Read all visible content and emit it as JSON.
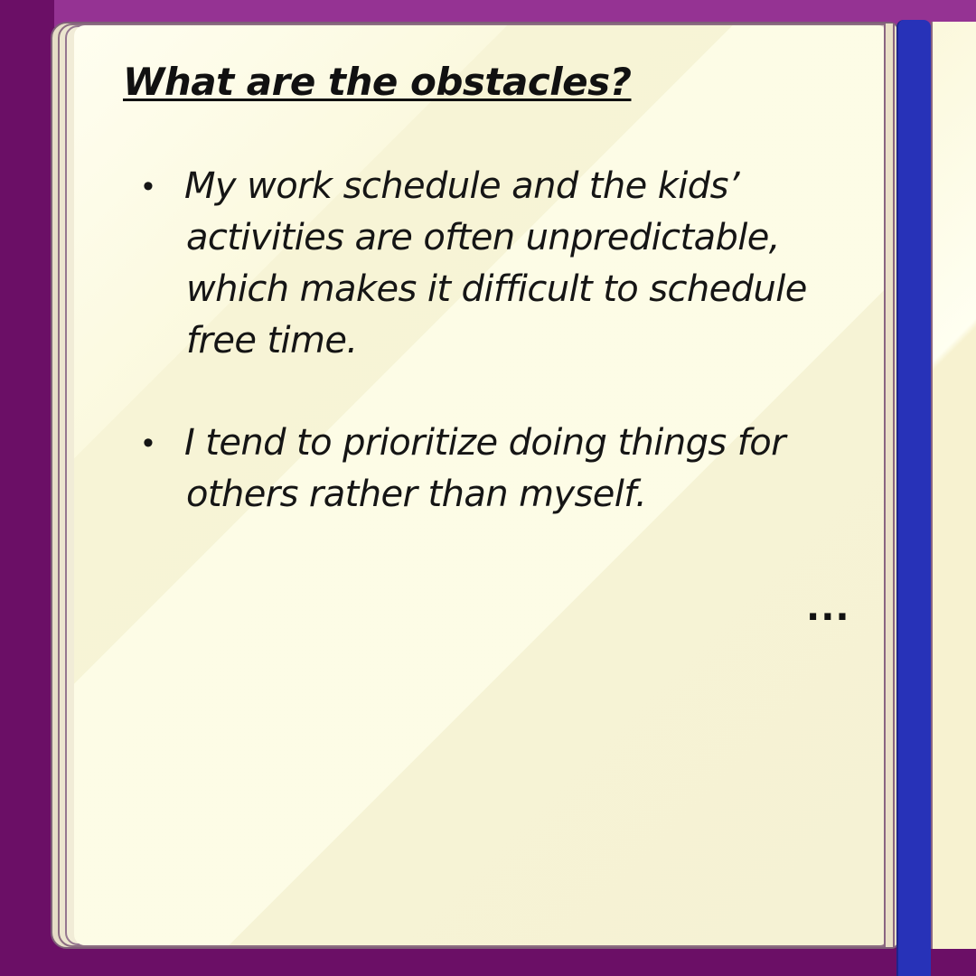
{
  "heading": "What are the obstacles?",
  "obstacles": [
    {
      "bullet": "•",
      "text": "My work schedule and the kids’ activities are often unpredictable, which makes it difficult to schedule free time."
    },
    {
      "bullet": "•",
      "text": "I tend to prioritize doing things for others rather than myself."
    }
  ],
  "continuation_mark": "...",
  "colors": {
    "background": "#6b0f66",
    "ribbon": "#2732b8",
    "page": "#f5f2d4",
    "text": "#111111"
  }
}
